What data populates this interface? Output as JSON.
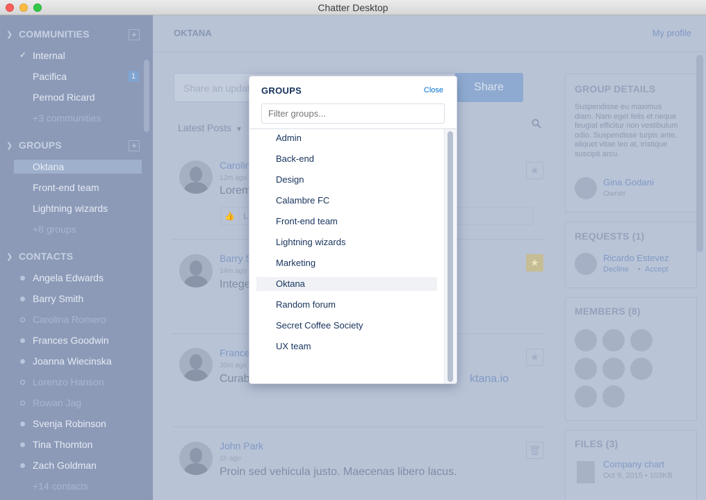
{
  "window": {
    "title": "Chatter Desktop"
  },
  "sidebar": {
    "communities": {
      "label": "COMMUNITIES",
      "items": [
        {
          "label": "Internal",
          "checked": true
        },
        {
          "label": "Pacifica",
          "badge": "1"
        },
        {
          "label": "Pernod Ricard"
        },
        {
          "label": "+3 communities"
        }
      ]
    },
    "groups": {
      "label": "GROUPS",
      "items": [
        {
          "label": "Oktana",
          "active": true
        },
        {
          "label": "Front-end team"
        },
        {
          "label": "Lightning wizards"
        },
        {
          "label": "+8 groups"
        }
      ]
    },
    "contacts": {
      "label": "CONTACTS",
      "items": [
        {
          "label": "Angela Edwards",
          "online": true
        },
        {
          "label": "Barry Smith",
          "online": true
        },
        {
          "label": "Carolina Romero",
          "online": false
        },
        {
          "label": "Frances Goodwin",
          "online": true
        },
        {
          "label": "Joanna Wiecinska",
          "online": true
        },
        {
          "label": "Lorenzo Hanson",
          "online": false
        },
        {
          "label": "Rowan Jag",
          "online": false
        },
        {
          "label": "Svenja Robinson",
          "online": true
        },
        {
          "label": "Tina Thornton",
          "online": true
        },
        {
          "label": "Zach Goldman",
          "online": true
        },
        {
          "label": "+14 contacts"
        }
      ]
    }
  },
  "main": {
    "org": "OKTANA",
    "profile_link": "My profile",
    "share_placeholder": "Share an update",
    "share_button": "Share",
    "sort_label": "Latest Posts",
    "posts": [
      {
        "author": "Carolina Romero",
        "time": "12m ago",
        "text": "Lorem",
        "like_text": "L"
      },
      {
        "author": "Barry Smith",
        "time": "14m ago",
        "text": "Integer"
      },
      {
        "author": "Frances Goodwin",
        "time": "30m ago",
        "text": "Curabitur",
        "text_tail": "ktana.io"
      },
      {
        "author": "John Park",
        "time": "1h ago",
        "text": "Proin sed vehicula justo. Maecenas libero lacus."
      }
    ]
  },
  "details": {
    "group_details": {
      "title": "GROUP DETAILS",
      "description": "Suspendisse eu maximus diam. Nam eget felis et neque feugiat efficitur non vestibulum odio. Suspendisse turpis ante, aliquet vitae leo at, tristique suscipit arcu.",
      "owner_name": "Gina Godani",
      "owner_role": "Owner"
    },
    "requests": {
      "title": "REQUESTS (1)",
      "name": "Ricardo Estevez",
      "decline": "Decline",
      "sep": "•",
      "accept": "Accept"
    },
    "members": {
      "title": "MEMBERS (8)"
    },
    "files": {
      "title": "FILES (3)",
      "items": [
        {
          "name": "Company chart",
          "meta": "Oct 9, 2015 • 103KB"
        }
      ]
    }
  },
  "modal": {
    "title": "GROUPS",
    "close": "Close",
    "filter_placeholder": "Filter groups...",
    "items": [
      "Admin",
      "Back-end",
      "Design",
      "Calambre FC",
      "Front-end team",
      "Lightning wizards",
      "Marketing",
      "Oktana",
      "Random forum",
      "Secret Coffee Society",
      "UX team"
    ],
    "selected": "Oktana"
  }
}
